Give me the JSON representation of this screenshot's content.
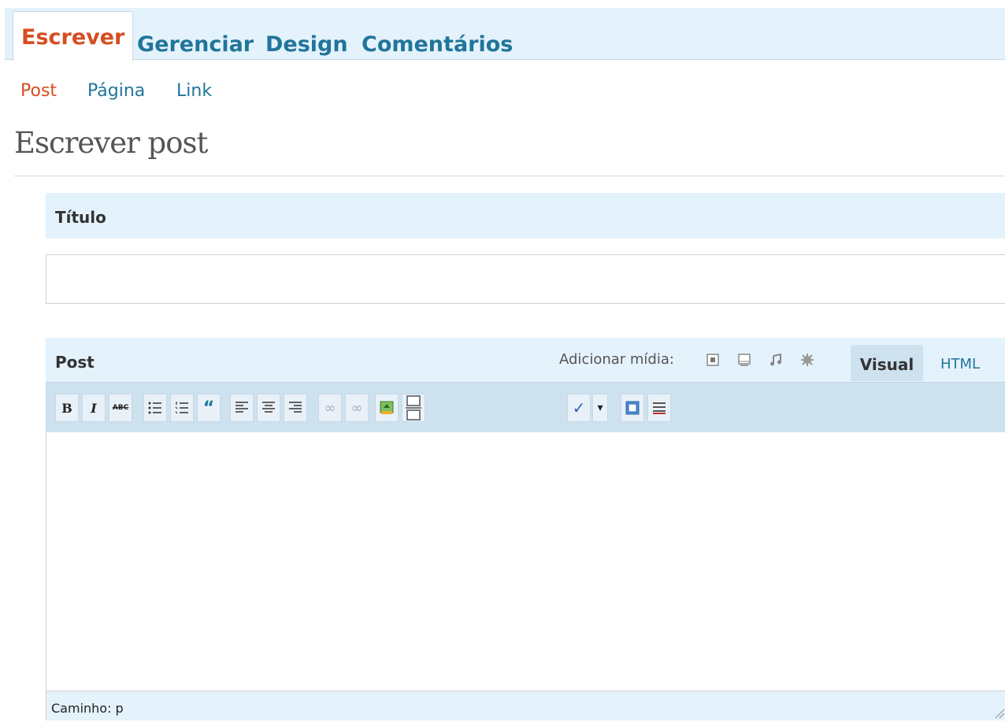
{
  "top_tabs": [
    {
      "label": "Escrever",
      "active": true
    },
    {
      "label": "Gerenciar",
      "active": false
    },
    {
      "label": "Design",
      "active": false
    },
    {
      "label": "Comentários",
      "active": false
    }
  ],
  "sub_nav": [
    {
      "label": "Post",
      "active": true
    },
    {
      "label": "Página",
      "active": false
    },
    {
      "label": "Link",
      "active": false
    }
  ],
  "page_title": "Escrever post",
  "title_section": {
    "label": "Título",
    "value": ""
  },
  "post_section": {
    "label": "Post",
    "add_media_label": "Adicionar mídia:",
    "media_icons": [
      "image-icon",
      "video-icon",
      "audio-icon",
      "media-icon"
    ],
    "editor_tabs": [
      {
        "label": "Visual",
        "active": true
      },
      {
        "label": "HTML",
        "active": false
      }
    ]
  },
  "toolbar": [
    {
      "name": "bold-button",
      "glyph": "B"
    },
    {
      "name": "italic-button",
      "glyph": "I"
    },
    {
      "name": "strikethrough-button",
      "glyph": "ABC"
    },
    {
      "name": "bullet-list-button",
      "glyph": "☰"
    },
    {
      "name": "numbered-list-button",
      "glyph": "☷"
    },
    {
      "name": "blockquote-button",
      "glyph": "“"
    },
    {
      "name": "align-left-button",
      "glyph": "☰"
    },
    {
      "name": "align-center-button",
      "glyph": "☰"
    },
    {
      "name": "align-right-button",
      "glyph": "☰"
    },
    {
      "name": "link-button",
      "glyph": "∞"
    },
    {
      "name": "unlink-button",
      "glyph": "∞"
    },
    {
      "name": "insert-image-button",
      "glyph": "▣"
    },
    {
      "name": "insert-more-button",
      "glyph": "▭"
    },
    {
      "name": "spellcheck-button",
      "glyph": "✓"
    },
    {
      "name": "spellcheck-dropdown-button",
      "glyph": "▾"
    },
    {
      "name": "fullscreen-button",
      "glyph": "▢"
    },
    {
      "name": "kitchen-sink-button",
      "glyph": "▤"
    }
  ],
  "editor": {
    "content": "",
    "path_label": "Caminho: p"
  },
  "colors": {
    "active": "#d54e21",
    "link": "#21759b",
    "tab_bg": "#e4f2fc",
    "toolbar_bg": "#cee1ef"
  }
}
